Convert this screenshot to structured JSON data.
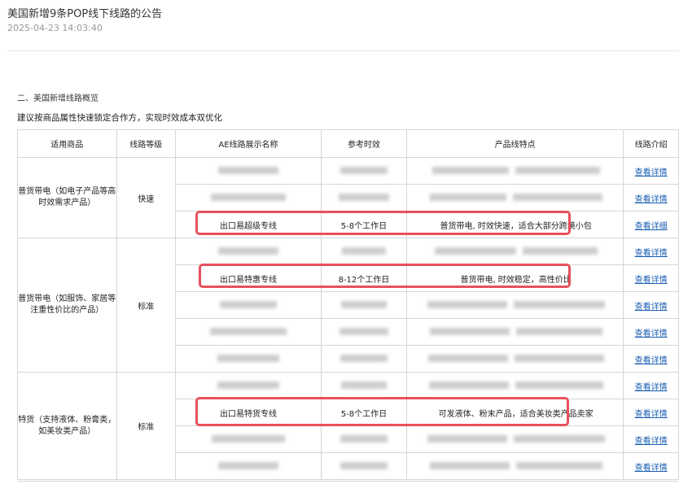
{
  "article": {
    "title": "美国新增9条POP线下线路的公告",
    "timestamp": "2025-04-23 14:03:40"
  },
  "section": {
    "heading": "二、美国新增线路概览",
    "subtitle": "建议按商品属性快速锁定合作方，实现时效成本双优化"
  },
  "table": {
    "headers": {
      "product": "适用商品",
      "level": "线路等级",
      "name": "AE线路展示名称",
      "time": "参考时效",
      "features": "产品线特点",
      "intro": "线路介绍"
    },
    "detail_link": "查看详情",
    "groups": [
      {
        "product": "普货带电（如电子产品等高时效需求产品）",
        "level": "快速"
      },
      {
        "product": "普货带电（如服饰、家居等注重性价比的产品）",
        "level": "标准"
      },
      {
        "product": "特货（支持液体、粉膏类，如美妆类产品）",
        "level": "标准"
      }
    ],
    "visible_rows": {
      "express": {
        "name": "出口易超级专线",
        "time": "5-8个工作日",
        "features": "普货带电, 时效快速，适合大部分跨境小包",
        "link": "查看详细"
      },
      "economy": {
        "name": "出口易特惠专线",
        "time": "8-12个工作日",
        "features": "普货带电, 时效稳定，高性价比",
        "link": "查看详情"
      },
      "special": {
        "name": "出口易特货专线",
        "time": "5-8个工作日",
        "features": "可发液体、粉末产品，适合美妆类产品卖家",
        "link": "查看详情"
      }
    }
  },
  "colors": {
    "highlight": "#e8505b",
    "link": "#1a5fb4"
  }
}
